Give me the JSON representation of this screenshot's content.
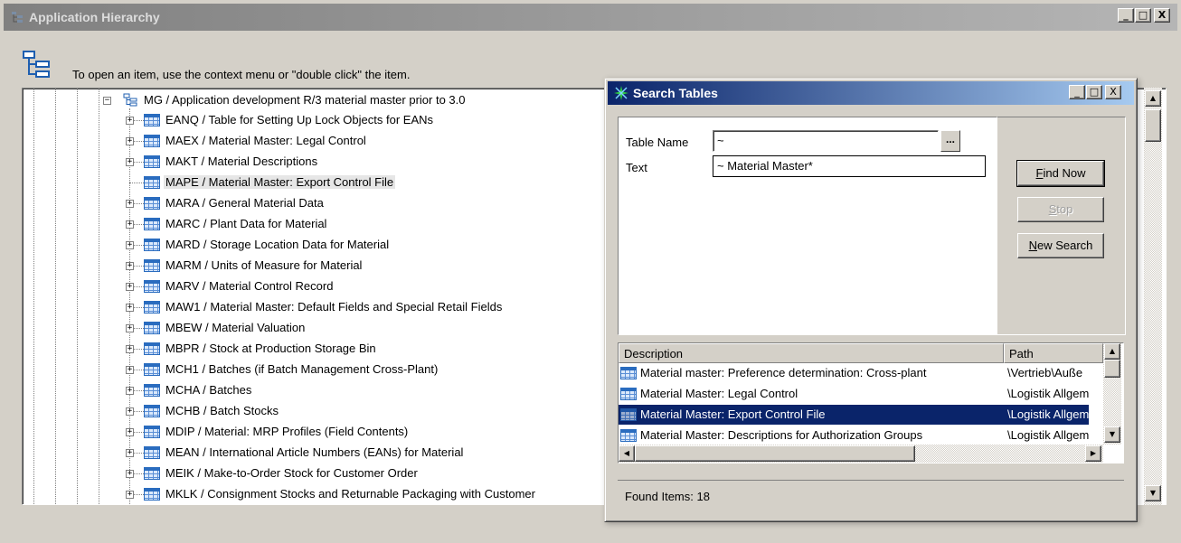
{
  "main_window": {
    "title": "Application Hierarchy",
    "controls": {
      "minimize": "_",
      "maximize": "□",
      "close": "X"
    },
    "hint": "To open an item, use the context menu or \"double click\" the item."
  },
  "tree": {
    "root": {
      "label": "MG / Application development R/3 material master prior to 3.0",
      "expander": "−"
    },
    "items": [
      {
        "label": "EANQ / Table for Setting Up Lock Objects for EANs",
        "expander": "+"
      },
      {
        "label": "MAEX / Material Master: Legal Control",
        "expander": "+"
      },
      {
        "label": "MAKT / Material Descriptions",
        "expander": "+"
      },
      {
        "label": "MAPE / Material Master: Export Control File",
        "expander": "",
        "selected": true
      },
      {
        "label": "MARA / General Material Data",
        "expander": "+"
      },
      {
        "label": "MARC / Plant Data for Material",
        "expander": "+"
      },
      {
        "label": "MARD / Storage Location Data for Material",
        "expander": "+"
      },
      {
        "label": "MARM / Units of Measure for Material",
        "expander": "+"
      },
      {
        "label": "MARV / Material Control Record",
        "expander": "+"
      },
      {
        "label": "MAW1 / Material Master: Default Fields and Special Retail Fields",
        "expander": "+"
      },
      {
        "label": "MBEW / Material Valuation",
        "expander": "+"
      },
      {
        "label": "MBPR / Stock at Production Storage Bin",
        "expander": "+"
      },
      {
        "label": "MCH1 / Batches (if Batch Management Cross-Plant)",
        "expander": "+"
      },
      {
        "label": "MCHA / Batches",
        "expander": "+"
      },
      {
        "label": "MCHB / Batch Stocks",
        "expander": "+"
      },
      {
        "label": "MDIP / Material: MRP Profiles (Field Contents)",
        "expander": "+"
      },
      {
        "label": "MEAN / International Article Numbers (EANs) for Material",
        "expander": "+"
      },
      {
        "label": "MEIK / Make-to-Order Stock for Customer Order",
        "expander": "+"
      },
      {
        "label": "MKLK / Consignment Stocks and Returnable Packaging with Customer",
        "expander": "+"
      }
    ]
  },
  "search_dialog": {
    "title": "Search Tables",
    "controls": {
      "minimize": "_",
      "maximize": "□",
      "close": "X"
    },
    "table_name_label": "Table Name",
    "table_name_value": "~",
    "browse_label": "...",
    "text_label": "Text",
    "text_value": "~ Material Master*",
    "find_now": {
      "prefix": "",
      "mnemonic": "F",
      "rest": "ind Now"
    },
    "stop": {
      "prefix": "",
      "mnemonic": "S",
      "rest": "top"
    },
    "new_search": {
      "prefix": "",
      "mnemonic": "N",
      "rest": "ew Search"
    },
    "columns": {
      "description": "Description",
      "path": "Path"
    },
    "results": [
      {
        "description": "Material master: Preference determination: Cross-plant",
        "path": "\\Vertrieb\\Auße"
      },
      {
        "description": "Material Master: Legal Control",
        "path": "\\Logistik Allgem"
      },
      {
        "description": "Material Master: Export Control File",
        "path": "\\Logistik Allgem",
        "selected": true
      },
      {
        "description": "Material Master: Descriptions for Authorization Groups",
        "path": "\\Logistik Allgem"
      }
    ],
    "status": "Found Items: 18"
  }
}
